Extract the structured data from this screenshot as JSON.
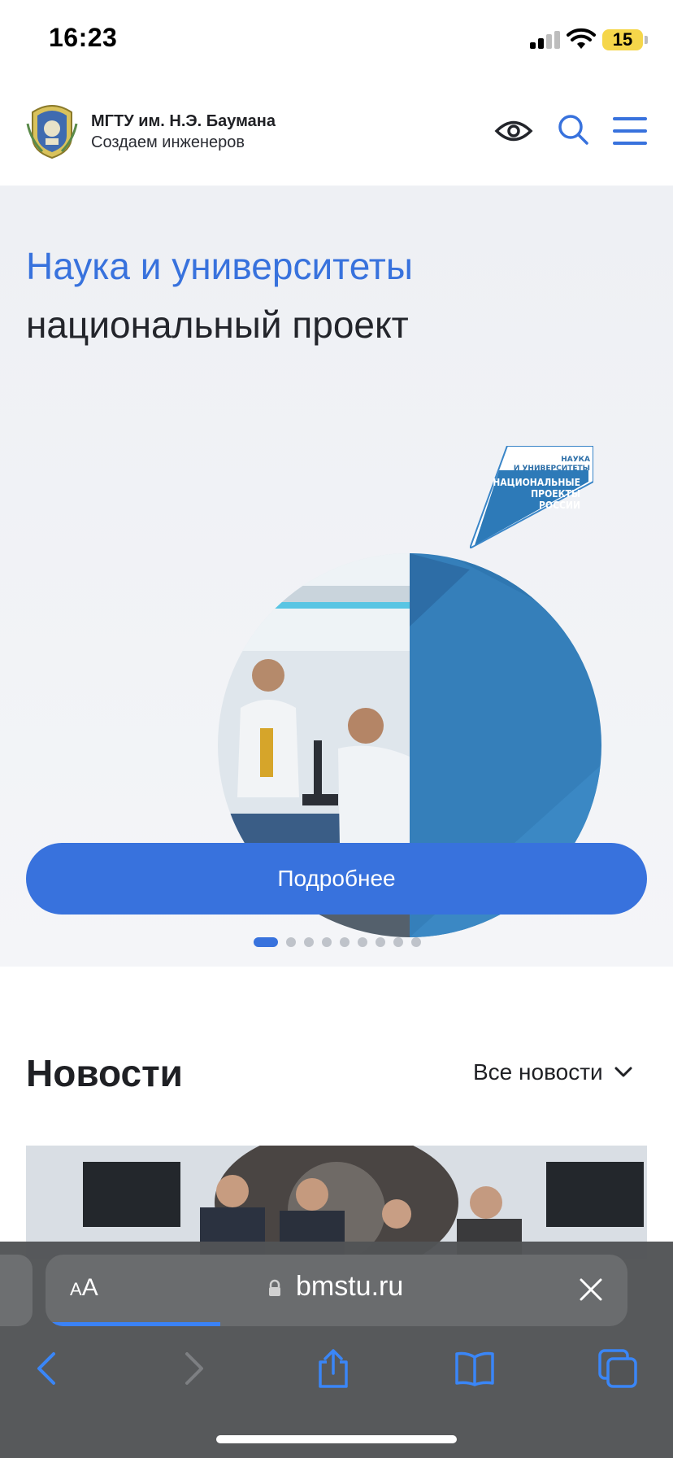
{
  "status_bar": {
    "time": "16:23",
    "battery": "15",
    "icons": [
      "signal-icon",
      "wifi-icon",
      "battery-icon"
    ]
  },
  "header": {
    "brand_name": "МГТУ им. Н.Э. Баумана",
    "brand_tagline": "Создаем инженеров",
    "icons": [
      "logo-icon",
      "eye-icon",
      "search-icon",
      "menu-icon"
    ],
    "accent_color": "#3872dd"
  },
  "hero": {
    "title": "Наука и университеты",
    "subtitle": "национальный проект",
    "badge_small": [
      "НАУКА",
      "И УНИВЕРСИТЕТЫ"
    ],
    "badge_big": [
      "НАЦИОНАЛЬНЫЕ",
      "ПРОЕКТЫ",
      "РОССИИ"
    ],
    "button_label": "Подробнее",
    "slides_count": 9,
    "active_slide": 1
  },
  "news": {
    "title": "Новости",
    "all_news_label": "Все новости"
  },
  "browser": {
    "aa_label": "AA",
    "url": "bmstu.ru",
    "load_progress": 0.3,
    "toolbar": [
      "back-icon",
      "forward-icon",
      "share-icon",
      "bookmarks-icon",
      "tabs-icon"
    ]
  }
}
